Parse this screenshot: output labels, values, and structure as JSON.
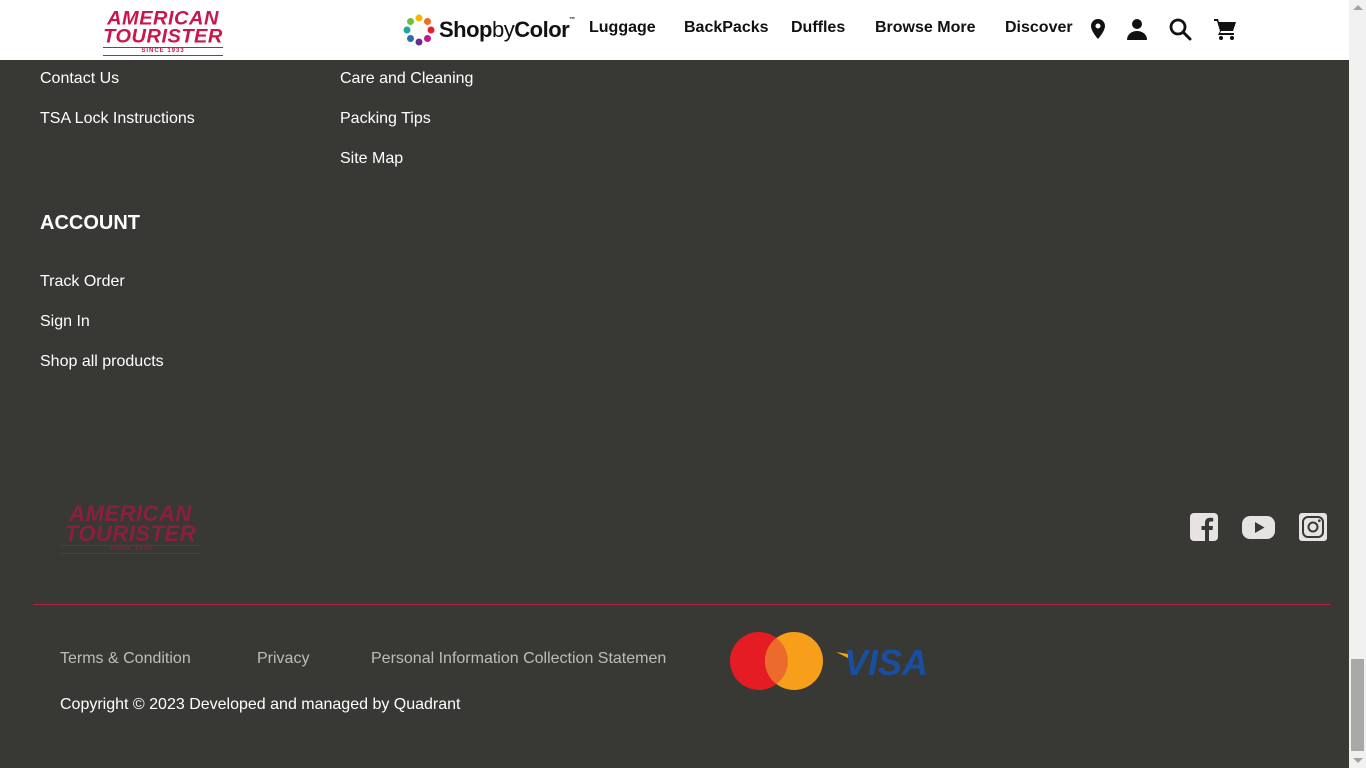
{
  "header": {
    "brand_line1": "AMERICAN",
    "brand_line2": "TOURISTER",
    "brand_since": "SINCE 1933",
    "shop_by_color": {
      "shop": "Shop",
      "by": "by",
      "color": "Color",
      "tm": "™"
    },
    "nav": [
      "Luggage",
      "BackPacks",
      "Duffles",
      "Browse More",
      "Discover"
    ],
    "icons": [
      "location-pin-icon",
      "user-icon",
      "search-icon",
      "cart-icon"
    ]
  },
  "footer": {
    "help_links": [
      "Contact Us",
      "TSA Lock Instructions"
    ],
    "info_links": [
      "Care and Cleaning",
      "Packing Tips",
      "Site Map"
    ],
    "account": {
      "heading": "ACCOUNT",
      "links": [
        "Track Order",
        "Sign In",
        "Shop all products"
      ]
    },
    "brand_line1": "AMERICAN",
    "brand_line2": "TOURISTER",
    "brand_since": "SINCE 1933",
    "social": [
      "facebook-icon",
      "youtube-icon",
      "instagram-icon"
    ],
    "legal": [
      "Terms & Condition",
      "Privacy",
      "Personal Information Collection Statemen"
    ],
    "payment": [
      "mastercard-icon",
      "visa-icon"
    ],
    "visa_text": "VISA",
    "copyright": "Copyright © 2023 Developed and managed by Quadrant"
  },
  "colors": {
    "background": "#383835",
    "brand_red": "#c8174b",
    "divider": "#a8243f"
  }
}
